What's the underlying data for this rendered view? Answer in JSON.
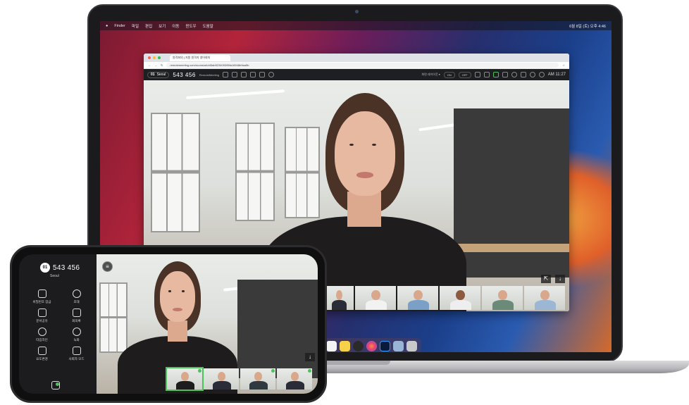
{
  "colors": {
    "accent_green": "#4cc35a",
    "toolbar_bg": "#1e1f23",
    "phone_sidebar_bg": "#1c1c1e"
  },
  "mac_menubar": {
    "app": "Finder",
    "menus": [
      "파일",
      "편집",
      "보기",
      "이동",
      "윈도우",
      "도움말"
    ],
    "clock": "6월 8일 (토) 오후 4:46"
  },
  "browser": {
    "tab_title": "원격회의 | 지원 원격지 영어회의",
    "url": "remotemeeting.com/rooms/a4d45ab523405395fa16948b9aa5b"
  },
  "meeting": {
    "room_badge": "01",
    "room_city": "Seoul",
    "room_number": "543 456",
    "brand": "RemoteMeeting",
    "layout_label": "화면 레이아웃 ▾",
    "on_label": "ON",
    "off_label": "OFF",
    "time": "AM 11:27"
  },
  "thumbnails": [
    "participant-1",
    "participant-2",
    "participant-3",
    "participant-4",
    "participant-5",
    "participant-6",
    "participant-7"
  ],
  "phone": {
    "room_badge": "01",
    "room_number": "543 456",
    "city": "Seoul",
    "menu": [
      {
        "label": "비밀번호 잠금",
        "icon": "lock-icon"
      },
      {
        "label": "초대",
        "icon": "invite-icon"
      },
      {
        "label": "문서공유",
        "icon": "document-icon"
      },
      {
        "label": "회의록",
        "icon": "notes-icon"
      },
      {
        "label": "타임라인",
        "icon": "timeline-icon"
      },
      {
        "label": "녹화",
        "icon": "record-icon"
      },
      {
        "label": "요도변경",
        "icon": "layout-icon"
      },
      {
        "label": "사회자 모드",
        "icon": "crown-icon"
      }
    ]
  }
}
